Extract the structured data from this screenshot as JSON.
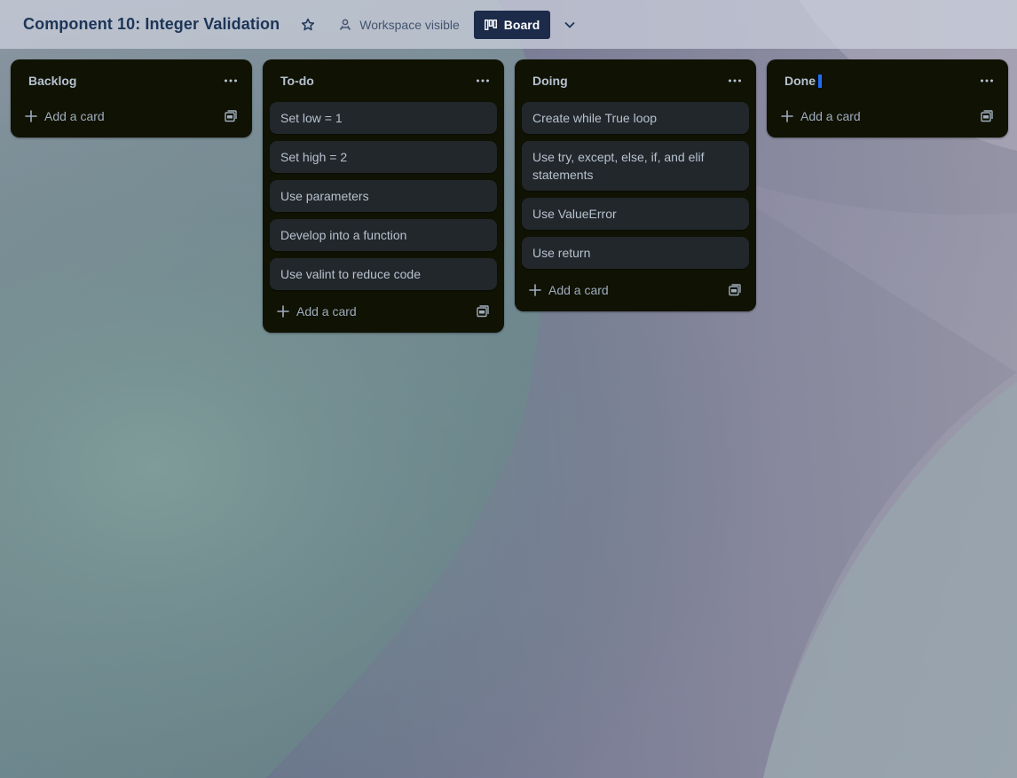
{
  "header": {
    "board_title": "Component 10: Integer Validation",
    "star_icon": "star-icon",
    "visibility_label": "Workspace visible",
    "visibility_icon": "people-icon",
    "view_label": "Board",
    "view_icon": "board-columns-icon",
    "view_menu_icon": "chevron-down-icon"
  },
  "lists": [
    {
      "title": "Backlog",
      "cards": [],
      "add_card_label": "Add a card"
    },
    {
      "title": "To-do",
      "cards": [
        "Set low = 1",
        "Set high = 2",
        "Use parameters",
        "Develop into a function",
        "Use valint to reduce code"
      ],
      "add_card_label": "Add a card"
    },
    {
      "title": "Doing",
      "cards": [
        "Create while True loop",
        "Use try, except, else, if, and elif statements",
        "Use ValueError",
        "Use return"
      ],
      "add_card_label": "Add a card"
    },
    {
      "title": "Done",
      "cards": [],
      "add_card_label": "Add a card"
    }
  ],
  "colors": {
    "header_title": "#1d3557",
    "list_bg": "#101204",
    "card_bg": "#22272b",
    "card_text": "#b6c2cf",
    "board_button_bg": "#1c2b4a",
    "cursor_highlight": "#1f6feb"
  }
}
